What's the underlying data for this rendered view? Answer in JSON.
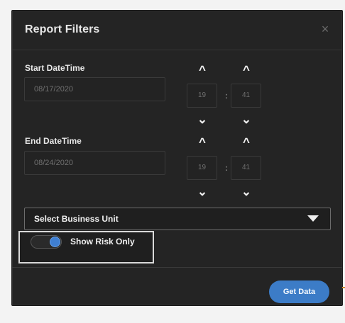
{
  "dialog": {
    "title": "Report Filters",
    "close_label": "×"
  },
  "start": {
    "label": "Start DateTime",
    "date": "08/17/2020",
    "hour": "19",
    "minute": "41",
    "colon": ":",
    "up_icon": "chevron-up",
    "down_icon": "chevron-down",
    "arrow_up": "^",
    "arrow_down": "⌄"
  },
  "end": {
    "label": "End DateTime",
    "date": "08/24/2020",
    "hour": "19",
    "minute": "41",
    "colon": ":",
    "up_icon": "chevron-up",
    "down_icon": "chevron-down",
    "arrow_up": "^",
    "arrow_down": "⌄"
  },
  "filters": {
    "business_unit_placeholder": "Select Business Unit",
    "show_risk_only_label": "Show Risk Only",
    "toggle_state": "on"
  },
  "actions": {
    "get_data_label": "Get Data"
  },
  "colors": {
    "background": "#242424",
    "accent": "#3c7cc7",
    "highlight": "#d9d9d9"
  }
}
